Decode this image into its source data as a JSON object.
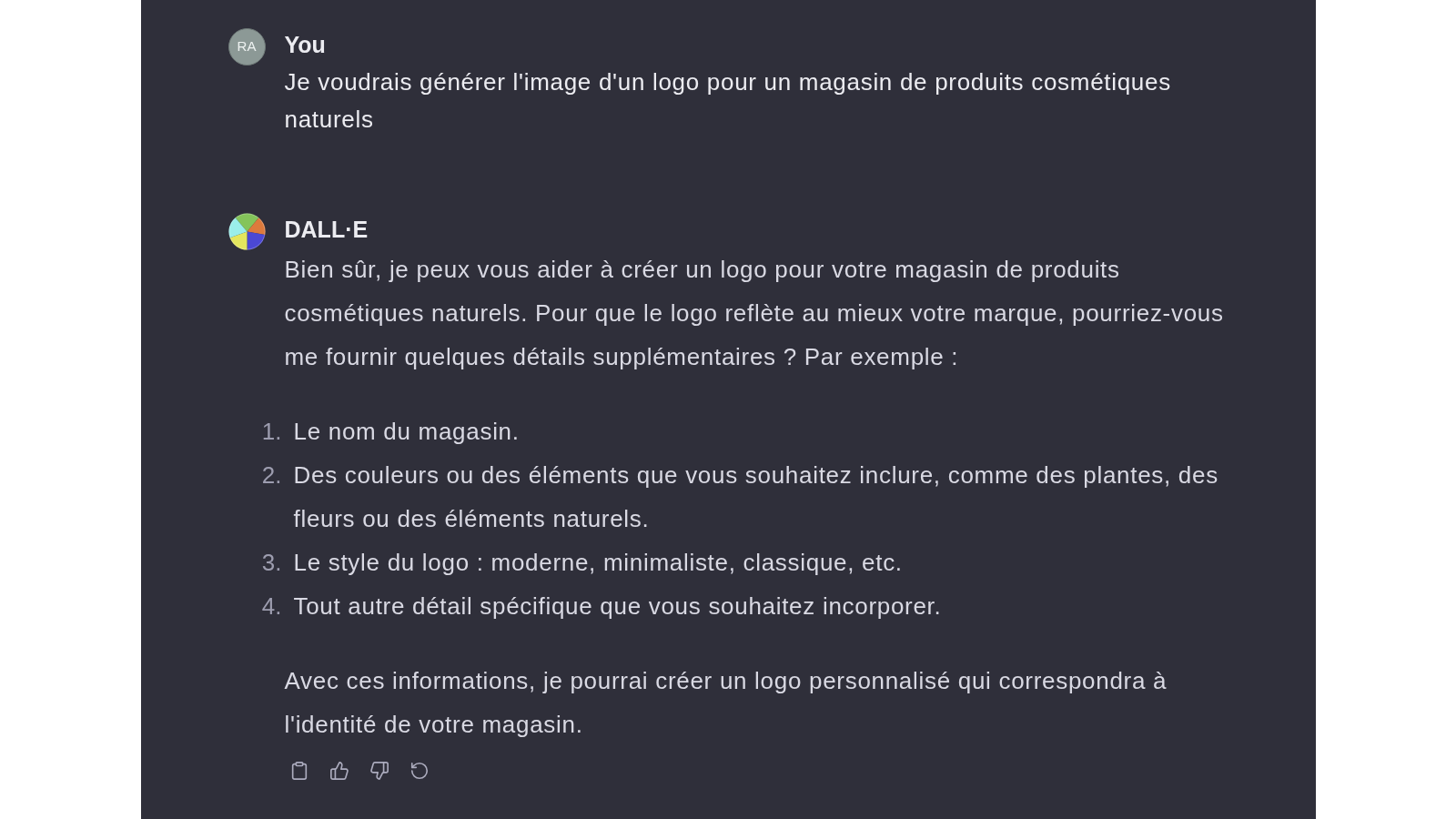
{
  "messages": [
    {
      "kind": "user",
      "avatar_initials": "RA",
      "author": "You",
      "blocks": [
        {
          "kind": "paragraph",
          "text": "Je voudrais générer l'image d'un logo pour un magasin de produits cosmétiques naturels"
        }
      ]
    },
    {
      "kind": "assistant",
      "author": "DALL·E",
      "blocks": [
        {
          "kind": "paragraph",
          "text": "Bien sûr, je peux vous aider à créer un logo pour votre magasin de produits cosmétiques naturels. Pour que le logo reflète au mieux votre marque, pourriez-vous me fournir quelques détails supplémentaires ? Par exemple :"
        },
        {
          "kind": "numbered_list",
          "items": [
            {
              "number": "1.",
              "text": "Le nom du magasin."
            },
            {
              "number": "2.",
              "text": "Des couleurs ou des éléments que vous souhaitez inclure, comme des plantes, des fleurs ou des éléments naturels."
            },
            {
              "number": "3.",
              "text": "Le style du logo : moderne, minimaliste, classique, etc."
            },
            {
              "number": "4.",
              "text": "Tout autre détail spécifique que vous souhaitez incorporer."
            }
          ]
        },
        {
          "kind": "paragraph",
          "text": "Avec ces informations, je pourrai créer un logo personnalisé qui correspondra à l'identité de votre magasin."
        }
      ]
    }
  ]
}
